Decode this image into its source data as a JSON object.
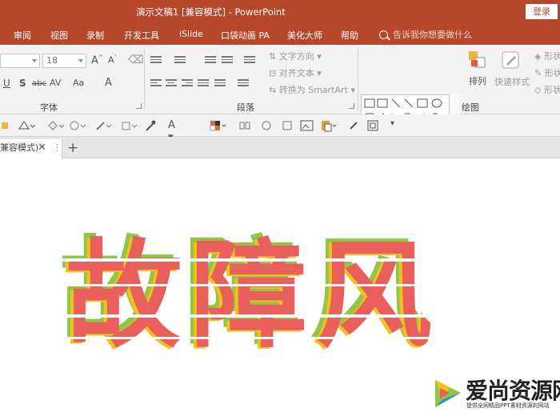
{
  "title_bar": {
    "title": "演示文稿1 [兼容模式] - PowerPoint",
    "login_label": "登录",
    "bg_color": "#b7472a"
  },
  "ribbon_tabs": [
    {
      "label": "审阅"
    },
    {
      "label": "视图"
    },
    {
      "label": "录制"
    },
    {
      "label": "开发工具"
    },
    {
      "label": "iSlide"
    },
    {
      "label": "口袋动画 PA"
    },
    {
      "label": "美化大师"
    },
    {
      "label": "帮助"
    }
  ],
  "tell_me": {
    "placeholder": "告诉我你想要做什么",
    "icon": "search-icon"
  },
  "font_group": {
    "font_name": "",
    "font_size": "18",
    "label": "字体",
    "buttons": [
      "U",
      "S",
      "abc",
      "AV",
      "Aa",
      "A"
    ]
  },
  "paragraph_group": {
    "label": "段落",
    "text_direction": "文字方向",
    "align_text": "对齐文本",
    "convert_smartart": "转换为 SmartArt"
  },
  "drawing_group": {
    "label": "绘图",
    "arrange": "排列",
    "quick_styles": "快速样式",
    "shape_fill": "形状",
    "shape_outline": "形状",
    "shape_effects": "形状"
  },
  "document_tab": {
    "name": "兼容模式)",
    "close": "✕",
    "more": "⋮",
    "add": "+"
  },
  "slide": {
    "text": "故障风",
    "colors": {
      "red": "#e85f5c",
      "yellow": "#f2c21b",
      "green": "#8fc646"
    }
  },
  "watermark": {
    "brand": "爱尚资源网",
    "sub": "提供全网精品PPT素材资源的网站"
  }
}
